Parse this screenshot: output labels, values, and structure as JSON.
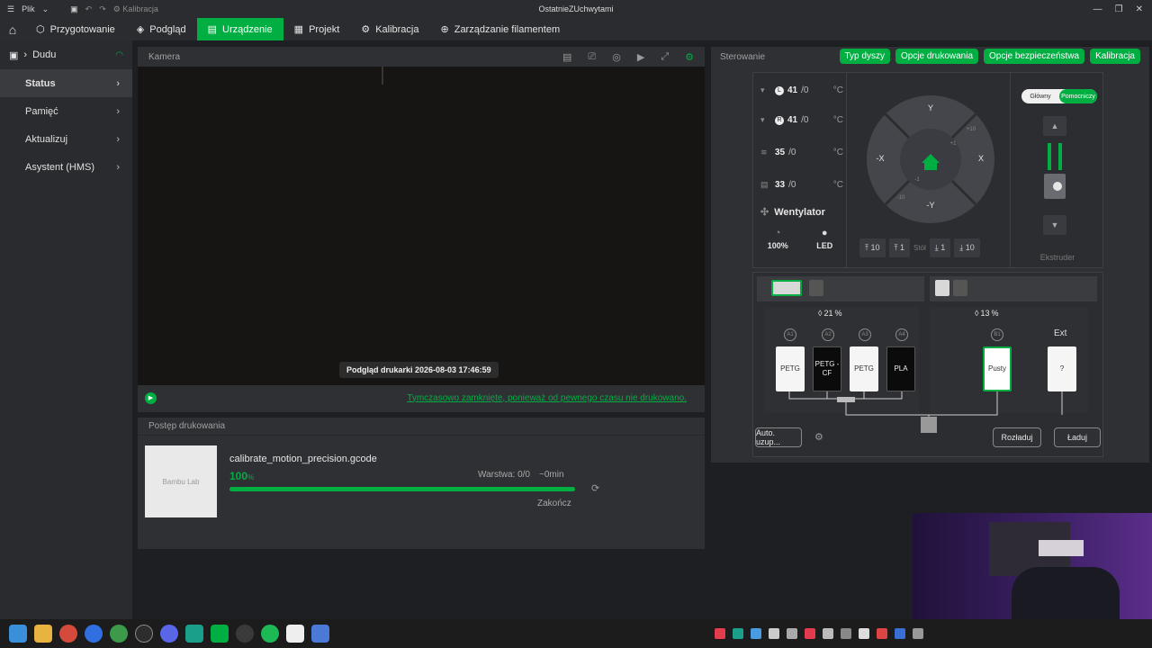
{
  "titlebar": {
    "menu": "Plik",
    "calib_hint": "Kalibracja",
    "window_title": "OstatnieZUchwytami"
  },
  "nav": {
    "tabs": [
      {
        "label": "Przygotowanie"
      },
      {
        "label": "Podgląd"
      },
      {
        "label": "Urządzenie"
      },
      {
        "label": "Projekt"
      },
      {
        "label": "Kalibracja"
      },
      {
        "label": "Zarządzanie filamentem"
      }
    ],
    "active": "Urządzenie"
  },
  "sidebar": {
    "printer": "Dudu",
    "items": [
      {
        "label": "Status"
      },
      {
        "label": "Pamięć"
      },
      {
        "label": "Aktualizuj"
      },
      {
        "label": "Asystent (HMS)"
      }
    ]
  },
  "camera": {
    "title": "Kamera",
    "stamp": "Podgląd drukarki  2026-08-03 17:46:59",
    "message": "Tymczasowo zamknięte, ponieważ od pewnego czasu nie drukowano."
  },
  "progress": {
    "title": "Postęp drukowania",
    "thumb_label": "Bambu Lab",
    "file": "calibrate_motion_precision.gcode",
    "percent": "100",
    "percent_unit": "%",
    "progress_fraction": 1.0,
    "layer": "Warstwa: 0/0",
    "eta": "~0min",
    "finish": "Zakończ"
  },
  "control": {
    "title": "Sterowanie",
    "buttons": [
      "Typ dyszy",
      "Opcje drukowania",
      "Opcje bezpieczeństwa",
      "Kalibracja"
    ],
    "temps": [
      {
        "badge": "L",
        "value": "41",
        "target": "/0",
        "unit": "°C"
      },
      {
        "badge": "R",
        "value": "41",
        "target": "/0",
        "unit": "°C"
      },
      {
        "badge": "",
        "value": "35",
        "target": "/0",
        "unit": "°C"
      },
      {
        "badge": "",
        "value": "33",
        "target": "/0",
        "unit": "°C"
      }
    ],
    "fan": "Wentylator",
    "speed": "100%",
    "led": "LED",
    "jog": {
      "y_plus": "Y",
      "y_minus": "-Y",
      "x_plus": "X",
      "x_minus": "-X",
      "step_a": "+10",
      "step_b": "+1",
      "step_c": "-1",
      "step_d": "-10"
    },
    "z": {
      "up10": "10",
      "up1": "1",
      "label": "Stół",
      "down1": "1",
      "down10": "10"
    },
    "extruder": {
      "main": "Główny",
      "aux": "Pomocniczy",
      "label": "Ekstruder"
    }
  },
  "ams": {
    "left_humidity": "21",
    "right_humidity": "13",
    "humidity_unit": "%",
    "slots": [
      {
        "id": "A1",
        "label": "PETG",
        "color": "#f5f5f5"
      },
      {
        "id": "A2",
        "label": "PETG -CF",
        "color": "#0b0b0b"
      },
      {
        "id": "A3",
        "label": "PETG",
        "color": "#f5f5f5"
      },
      {
        "id": "A4",
        "label": "PLA",
        "color": "#0b0b0b"
      },
      {
        "id": "B1",
        "label": "Pusty",
        "color": "#ffffff"
      }
    ],
    "ext_label": "Ext",
    "ext_value": "?",
    "auto_btn": "Auto. uzup...",
    "unload": "Rozładuj",
    "load": "Ładuj"
  }
}
